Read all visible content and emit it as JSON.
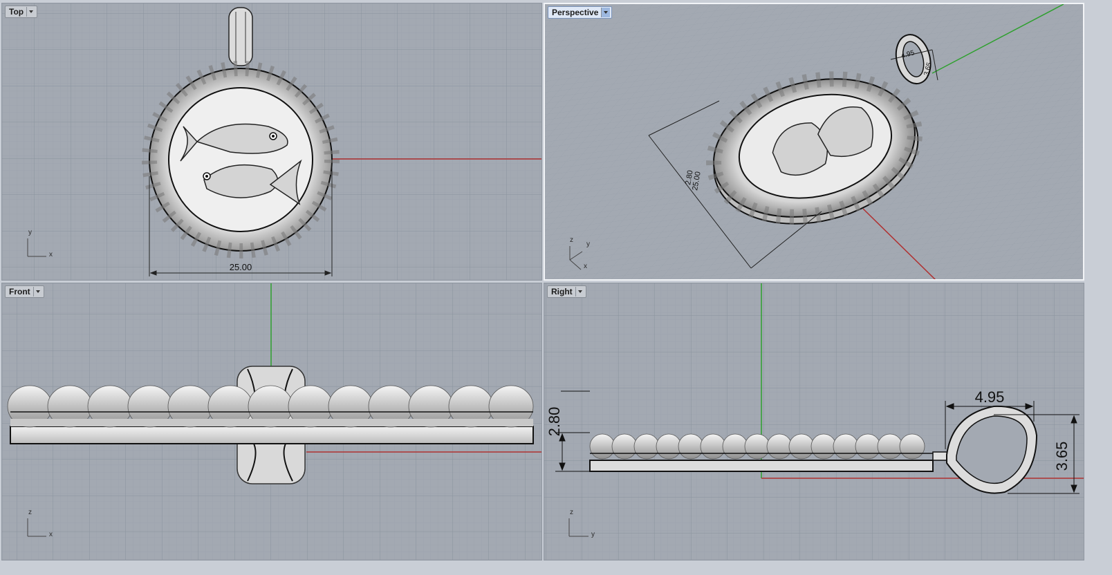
{
  "viewports": {
    "top": {
      "label": "Top",
      "dimension": "25.00",
      "axis_v": "y",
      "axis_h": "x"
    },
    "perspective": {
      "label": "Perspective",
      "dims": [
        "4.95",
        "3.65",
        "25.00",
        "2.80"
      ],
      "axis_z": "z",
      "axis_y": "y",
      "axis_x": "x"
    },
    "front": {
      "label": "Front",
      "axis_v": "z",
      "axis_h": "x"
    },
    "right": {
      "label": "Right",
      "dims": [
        "2.80",
        "4.95",
        "3.65"
      ],
      "axis_v": "z",
      "axis_h": "y"
    }
  },
  "colors": {
    "viewport_bg": "#a3a9b2",
    "grid_minor": "#98a0aa",
    "grid_major": "#8a929d",
    "x_axis": "#b03030",
    "y_axis": "#2ea02e",
    "model": "#e6e6e6"
  },
  "dropdown_icon": "chevron-down-icon"
}
